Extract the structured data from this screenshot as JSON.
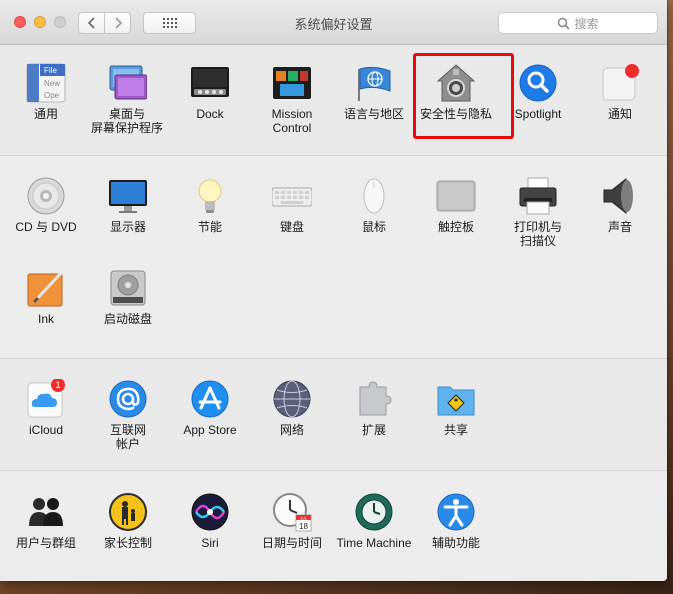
{
  "window": {
    "title": "系统偏好设置"
  },
  "toolbar": {
    "back_icon": "chevron-left-icon",
    "forward_icon": "chevron-right-icon",
    "grid_icon": "grid-icon"
  },
  "search": {
    "placeholder": "搜索",
    "icon": "magnifier-icon"
  },
  "sections": [
    {
      "name": "personal",
      "items": [
        {
          "label": "通用",
          "icon": "general-icon"
        },
        {
          "label": "桌面与\n屏幕保护程序",
          "icon": "desktop-screensaver-icon"
        },
        {
          "label": "Dock",
          "icon": "dock-icon"
        },
        {
          "label": "Mission\nControl",
          "icon": "mission-control-icon"
        },
        {
          "label": "语言与地区",
          "icon": "language-region-icon"
        },
        {
          "label": "安全性与隐私",
          "icon": "security-privacy-icon"
        },
        {
          "label": "Spotlight",
          "icon": "spotlight-icon"
        },
        {
          "label": "通知",
          "icon": "notifications-icon"
        }
      ]
    },
    {
      "name": "hardware",
      "items": [
        {
          "label": "CD 与 DVD",
          "icon": "cd-dvd-icon"
        },
        {
          "label": "显示器",
          "icon": "displays-icon"
        },
        {
          "label": "节能",
          "icon": "energy-saver-icon"
        },
        {
          "label": "键盘",
          "icon": "keyboard-icon"
        },
        {
          "label": "鼠标",
          "icon": "mouse-icon"
        },
        {
          "label": "触控板",
          "icon": "trackpad-icon"
        },
        {
          "label": "打印机与\n扫描仪",
          "icon": "printer-scanner-icon"
        },
        {
          "label": "声音",
          "icon": "sound-icon"
        },
        {
          "label": "Ink",
          "icon": "ink-icon"
        },
        {
          "label": "启动磁盘",
          "icon": "startup-disk-icon"
        }
      ]
    },
    {
      "name": "internet",
      "items": [
        {
          "label": "iCloud",
          "icon": "icloud-icon",
          "badge": "1"
        },
        {
          "label": "互联网\n帐户",
          "icon": "internet-accounts-icon"
        },
        {
          "label": "App Store",
          "icon": "app-store-icon"
        },
        {
          "label": "网络",
          "icon": "network-icon"
        },
        {
          "label": "扩展",
          "icon": "extensions-icon"
        },
        {
          "label": "共享",
          "icon": "sharing-icon"
        }
      ]
    },
    {
      "name": "system",
      "items": [
        {
          "label": "用户与群组",
          "icon": "users-groups-icon"
        },
        {
          "label": "家长控制",
          "icon": "parental-controls-icon"
        },
        {
          "label": "Siri",
          "icon": "siri-icon"
        },
        {
          "label": "日期与时间",
          "icon": "date-time-icon"
        },
        {
          "label": "Time Machine",
          "icon": "time-machine-icon"
        },
        {
          "label": "辅助功能",
          "icon": "accessibility-icon"
        }
      ]
    }
  ],
  "icon_text": {
    "general_file": "File",
    "general_new": "New",
    "general_ope": "Ope",
    "calendar_month": "JUL",
    "calendar_day": "18"
  },
  "highlight": {
    "target": "安全性与隐私",
    "color": "#e60c0c"
  }
}
